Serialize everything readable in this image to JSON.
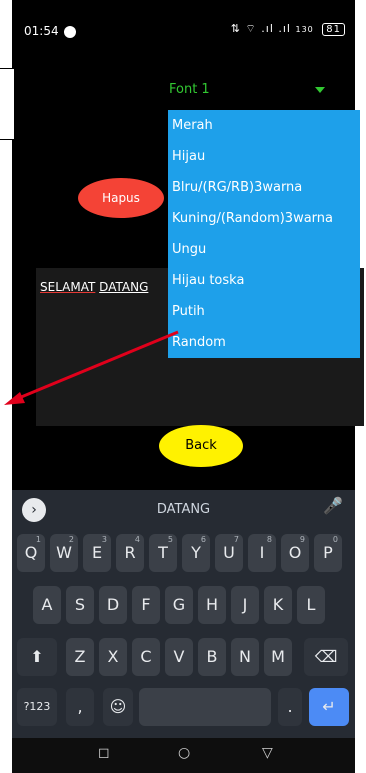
{
  "status": {
    "time": "01:54",
    "right_text": "⇅ ⌔ .ıl .ıl",
    "net_speed": "130",
    "battery": "81"
  },
  "font_select": {
    "value": "Font 1"
  },
  "dropdown": {
    "items": [
      "Merah",
      "Hijau",
      "Blru/(RG/RB)3warna",
      "Kuning/(Random)3warna",
      "Ungu",
      "Hijau toska",
      "Putih",
      "Random"
    ]
  },
  "buttons": {
    "hapus": "Hapus",
    "back": "Back"
  },
  "text_area": {
    "word1": "SELAMAT",
    "word2": "DATANG"
  },
  "keyboard": {
    "suggestion": "DATANG",
    "row1": [
      "Q",
      "W",
      "E",
      "R",
      "T",
      "Y",
      "U",
      "I",
      "O",
      "P"
    ],
    "row1_nums": [
      "1",
      "2",
      "3",
      "4",
      "5",
      "6",
      "7",
      "8",
      "9",
      "0"
    ],
    "row2": [
      "A",
      "S",
      "D",
      "F",
      "G",
      "H",
      "J",
      "K",
      "L"
    ],
    "row3": [
      "Z",
      "X",
      "C",
      "V",
      "B",
      "N",
      "M"
    ],
    "mode_key": "?123",
    "comma": ",",
    "period": "."
  },
  "colors": {
    "accent_dropdown": "#1ea0ea",
    "hapus": "#f44336",
    "back": "#fff200",
    "font_select": "#32c832",
    "annotation_arrow": "#e0001b"
  },
  "icons": [
    "signal-icon",
    "wifi-icon",
    "battery-icon",
    "dropdown-caret-icon",
    "chevron-right-icon",
    "mic-icon",
    "shift-icon",
    "backspace-icon",
    "emoji-icon",
    "enter-icon",
    "recents-icon",
    "home-icon",
    "back-nav-icon"
  ]
}
